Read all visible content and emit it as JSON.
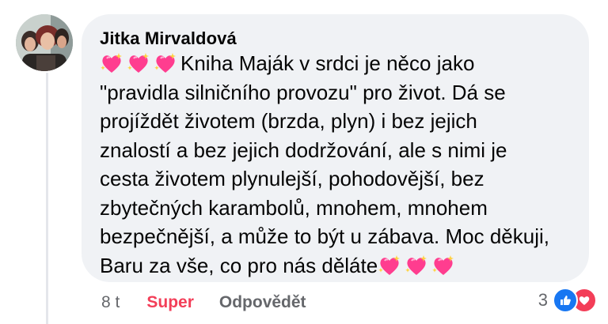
{
  "comment": {
    "author": "Jitka Mirvaldová",
    "lines": [
      "Kniha Maják v srdci je něco jako",
      "\"pravidla silničního provozu\" pro život.  Dá se",
      "projíždět životem (brzda, plyn) i bez jejich",
      "znalostí a bez jejich dodržování, ale s nimi je",
      "cesta životem plynulejší, pohodovější, bez",
      "zbytečných karambolů, mnohem, mnohem",
      "bezpečnější, a může to být u zábava. Moc děkuji,",
      "Baru za vše, co pro nás děláte"
    ],
    "leading_emoji": "sparkling-heart-icon",
    "trailing_emoji": "sparkling-heart-icon",
    "emoji_color": "#ff3d8f"
  },
  "actions": {
    "time": "8 t",
    "react_label": "Super",
    "reply_label": "Odpovědět"
  },
  "reactions": {
    "count": "3",
    "types": [
      "like-icon",
      "love-icon"
    ]
  }
}
